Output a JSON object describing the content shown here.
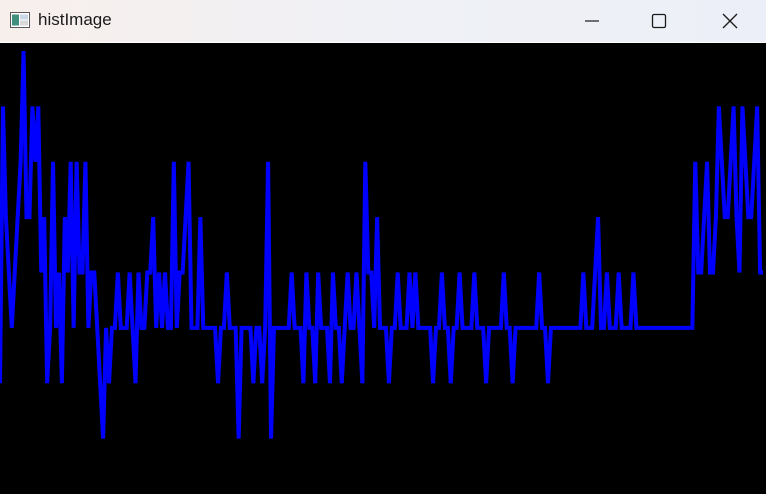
{
  "window": {
    "title": "histImage",
    "icon": "window-app-icon",
    "controls": [
      "minimize-icon",
      "maximize-icon",
      "close-icon"
    ]
  },
  "histogram": {
    "line_color": "#0000ff",
    "background_color": "#000000",
    "bins": 256,
    "levels": [
      2,
      7,
      5,
      4,
      3,
      4,
      5,
      6,
      8,
      5,
      5,
      7,
      6,
      7,
      4,
      5,
      2,
      3,
      6,
      3,
      4,
      2,
      5,
      4,
      6,
      3,
      6,
      4,
      4,
      6,
      3,
      4,
      4,
      3,
      2,
      1,
      3,
      2,
      3,
      3,
      4,
      3,
      3,
      3,
      4,
      3,
      2,
      4,
      3,
      3,
      4,
      4,
      5,
      3,
      4,
      3,
      4,
      3,
      3,
      6,
      3,
      4,
      4,
      5,
      6,
      3,
      3,
      3,
      5,
      3,
      3,
      3,
      3,
      3,
      2,
      3,
      3,
      4,
      3,
      3,
      3,
      1,
      3,
      3,
      3,
      3,
      2,
      3,
      3,
      2,
      3,
      6,
      1,
      3,
      3,
      3,
      3,
      3,
      3,
      4,
      3,
      3,
      3,
      2,
      4,
      3,
      3,
      2,
      4,
      3,
      3,
      3,
      2,
      4,
      3,
      3,
      2,
      3,
      4,
      3,
      3,
      4,
      3,
      2,
      6,
      4,
      4,
      3,
      5,
      3,
      3,
      3,
      2,
      3,
      3,
      4,
      3,
      3,
      3,
      4,
      3,
      4,
      3,
      3,
      3,
      3,
      3,
      2,
      3,
      3,
      4,
      3,
      3,
      2,
      3,
      3,
      4,
      3,
      3,
      3,
      3,
      4,
      3,
      3,
      3,
      2,
      3,
      3,
      3,
      3,
      3,
      4,
      3,
      3,
      2,
      3,
      3,
      3,
      3,
      3,
      3,
      3,
      3,
      4,
      3,
      3,
      2,
      3,
      3,
      3,
      3,
      3,
      3,
      3,
      3,
      3,
      3,
      3,
      4,
      3,
      3,
      3,
      4,
      5,
      3,
      3,
      4,
      3,
      3,
      3,
      4,
      3,
      3,
      3,
      3,
      4,
      3,
      3,
      3,
      3,
      3,
      3,
      3,
      3,
      3,
      3,
      3,
      3,
      3,
      3,
      3,
      3,
      3,
      3,
      3,
      3,
      6,
      4,
      4,
      5,
      6,
      4,
      4,
      5,
      7,
      6,
      5,
      5,
      6,
      7,
      5,
      4,
      7,
      6,
      5,
      5,
      6,
      7,
      4,
      4
    ],
    "level_max": 8
  }
}
